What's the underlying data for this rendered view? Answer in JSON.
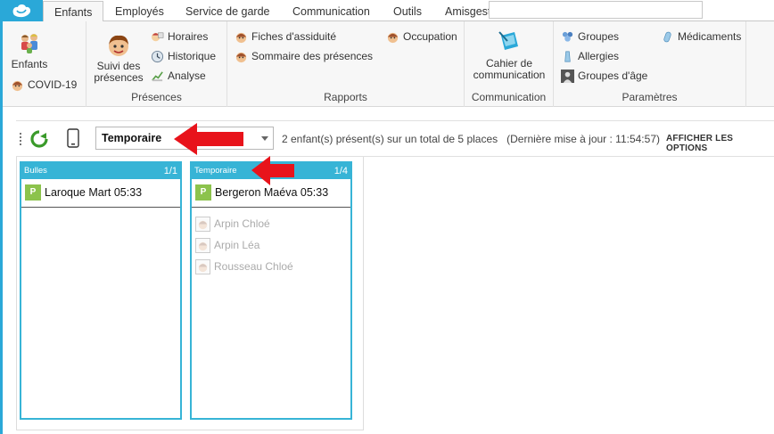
{
  "tabs": [
    {
      "label": "Enfants",
      "active": true
    },
    {
      "label": "Employés",
      "active": false
    },
    {
      "label": "Service de garde",
      "active": false
    },
    {
      "label": "Communication",
      "active": false
    },
    {
      "label": "Outils",
      "active": false
    },
    {
      "label": "Amisgest",
      "active": false
    }
  ],
  "ribbon": {
    "group_enfants": {
      "enfants_label": "Enfants",
      "covid_label": "COVID-19"
    },
    "group_presences": {
      "suivi_line1": "Suivi des",
      "suivi_line2": "présences",
      "horaires_label": "Horaires",
      "historique_label": "Historique",
      "analyse_label": "Analyse",
      "group_label": "Présences"
    },
    "group_rapports": {
      "fiches_label": "Fiches d'assiduité",
      "sommaire_label": "Sommaire des présences",
      "occupation_label": "Occupation",
      "group_label": "Rapports"
    },
    "group_communication": {
      "cahier_line1": "Cahier de",
      "cahier_line2": "communication",
      "group_label": "Communication"
    },
    "group_parametres": {
      "groupes_label": "Groupes",
      "allergies_label": "Allergies",
      "groupes_age_label": "Groupes d'âge",
      "medicaments_label": "Médicaments",
      "group_label": "Paramètres"
    }
  },
  "toolbar": {
    "selected_group": "Temporaire",
    "status_text": "2 enfant(s) présent(s) sur un total de 5 places   (Dernière mise à jour : 11:54:57)",
    "options_label": "AFFICHER LES OPTIONS"
  },
  "panels": [
    {
      "title": "Bulles",
      "count": "1/1",
      "present": [
        {
          "badge": "P",
          "name": "Laroque Mart 05:33"
        }
      ],
      "absent": []
    },
    {
      "title": "Temporaire",
      "count": "1/4",
      "present": [
        {
          "badge": "P",
          "name": "Bergeron Maéva 05:33"
        }
      ],
      "absent": [
        {
          "name": "Arpin Chloé"
        },
        {
          "name": "Arpin Léa"
        },
        {
          "name": "Rousseau Chloé"
        }
      ]
    }
  ],
  "colors": {
    "accent": "#2aa8d8",
    "panel_header": "#37b4d6",
    "present_badge": "#8cc34c",
    "annotation_arrow": "#e8131b"
  }
}
